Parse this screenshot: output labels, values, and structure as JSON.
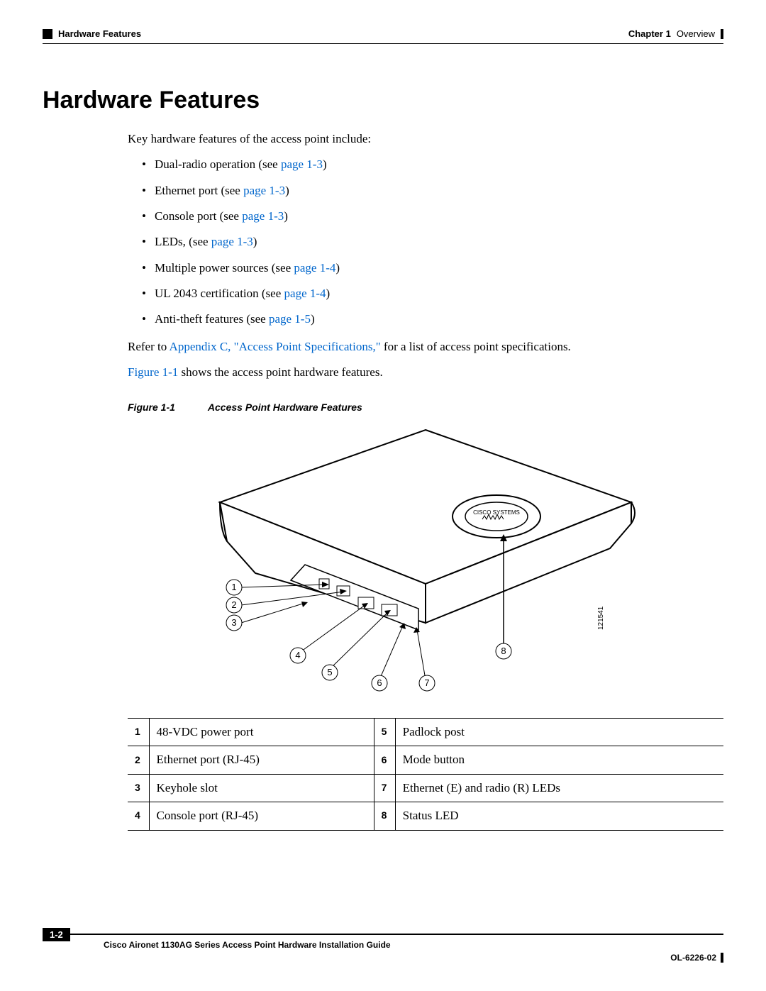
{
  "header": {
    "left_breadcrumb": "Hardware Features",
    "right_chapter": "Chapter 1",
    "right_title": "Overview"
  },
  "section_title": "Hardware Features",
  "intro": "Key hardware features of the access point include:",
  "bullets": [
    {
      "text": "Dual-radio operation (see ",
      "link": "page 1-3",
      "tail": ")"
    },
    {
      "text": "Ethernet port (see ",
      "link": "page 1-3",
      "tail": ")"
    },
    {
      "text": "Console port (see ",
      "link": "page 1-3",
      "tail": ")"
    },
    {
      "text": "LEDs, (see ",
      "link": "page 1-3",
      "tail": ")"
    },
    {
      "text": "Multiple power sources (see ",
      "link": "page 1-4",
      "tail": ")"
    },
    {
      "text": "UL 2043 certification (see ",
      "link": "page 1-4",
      "tail": ")"
    },
    {
      "text": "Anti-theft features (see ",
      "link": "page 1-5",
      "tail": ")"
    }
  ],
  "refer": {
    "pre": "Refer to ",
    "link": "Appendix C, \"Access Point Specifications,\"",
    "post": " for a list of access point specifications."
  },
  "shows": {
    "link": "Figure 1-1",
    "post": " shows the access point hardware features."
  },
  "figure": {
    "label": "Figure 1-1",
    "title": "Access Point Hardware Features",
    "brand_top": "CISCO SYSTEMS",
    "diagram_id": "121541",
    "callouts": [
      "1",
      "2",
      "3",
      "4",
      "5",
      "6",
      "7",
      "8"
    ]
  },
  "legend": [
    {
      "n": "1",
      "d": "48-VDC power port",
      "n2": "5",
      "d2": "Padlock post"
    },
    {
      "n": "2",
      "d": "Ethernet port (RJ-45)",
      "n2": "6",
      "d2": "Mode button"
    },
    {
      "n": "3",
      "d": "Keyhole slot",
      "n2": "7",
      "d2": "Ethernet (E) and radio (R) LEDs"
    },
    {
      "n": "4",
      "d": "Console port (RJ-45)",
      "n2": "8",
      "d2": "Status LED"
    }
  ],
  "footer": {
    "page_num": "1-2",
    "guide_title": "Cisco Aironet 1130AG Series Access Point Hardware Installation Guide",
    "doc_id": "OL-6226-02"
  }
}
